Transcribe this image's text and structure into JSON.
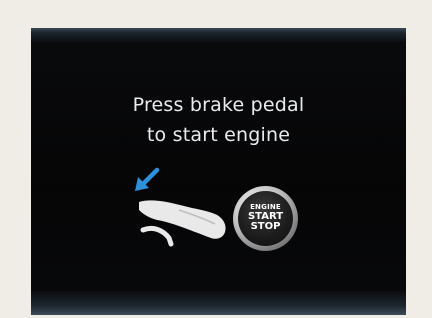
{
  "message": {
    "line1": "Press brake pedal",
    "line2": "to start engine"
  },
  "icons": {
    "pedal": "brake-pedal-press-icon",
    "button": "engine-start-stop-button-icon"
  },
  "engine_button": {
    "line1": "ENGINE",
    "line2": "START",
    "line3": "STOP"
  },
  "colors": {
    "background": "#efede6",
    "display": "#07080a",
    "text": "#e9ecef",
    "arrow": "#2f8fd8"
  }
}
